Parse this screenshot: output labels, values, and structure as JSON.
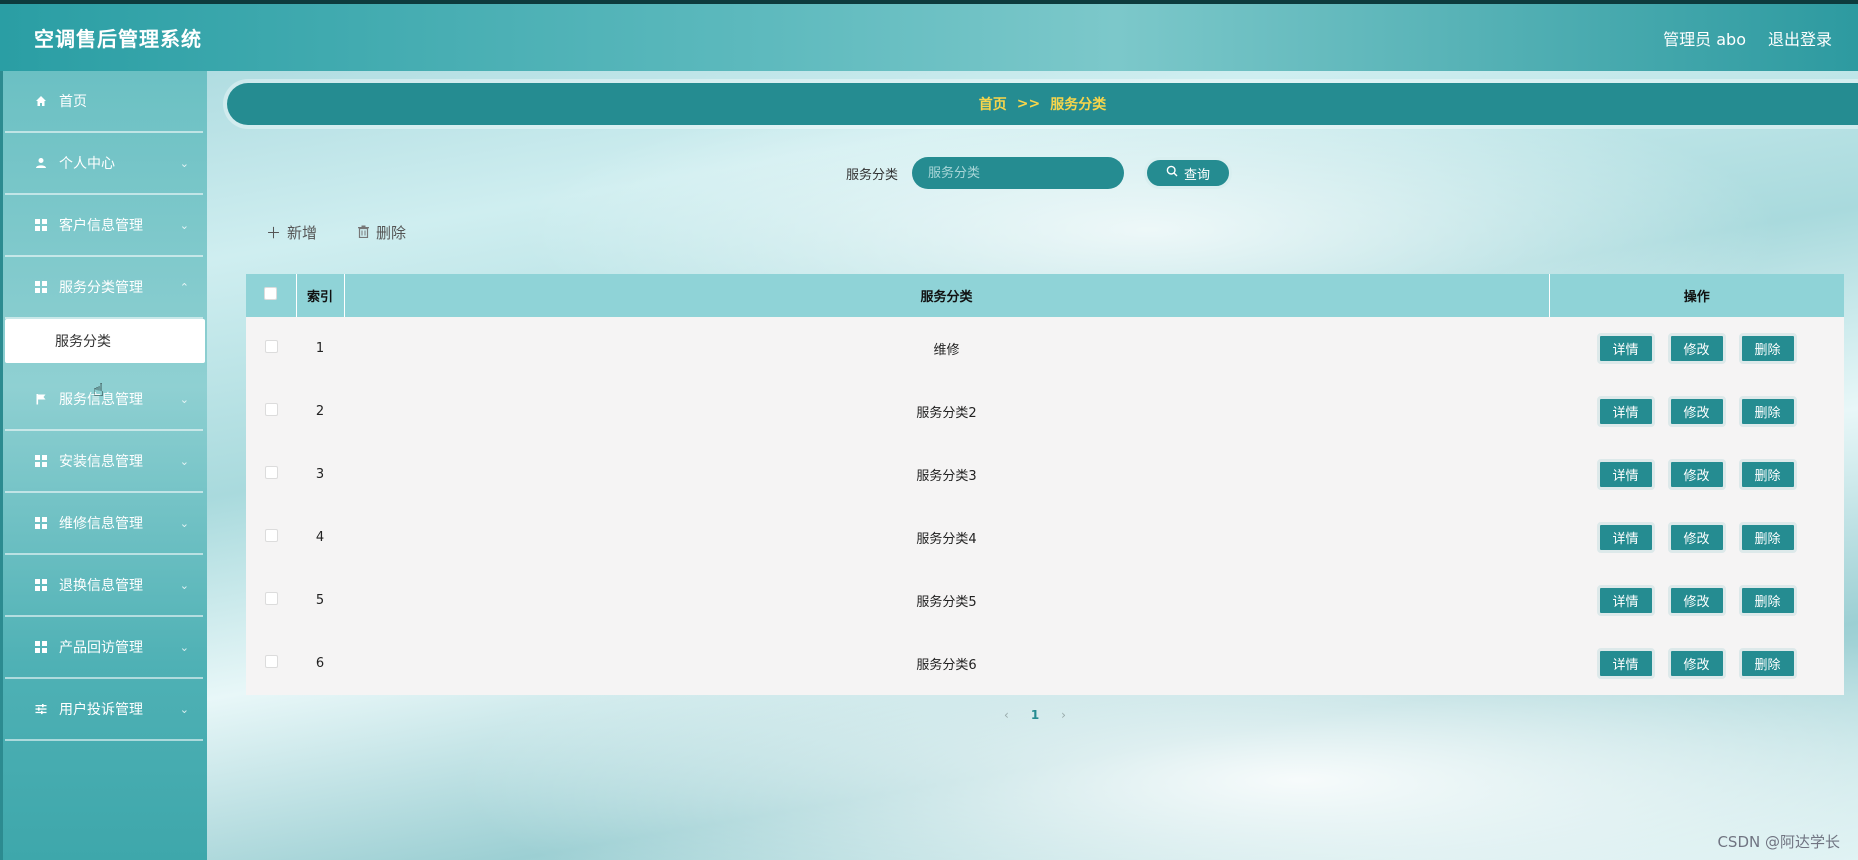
{
  "header": {
    "app_title": "空调售后管理系统",
    "user_label": "管理员 abo",
    "logout_label": "退出登录"
  },
  "sidebar": {
    "items": [
      {
        "label": "首页",
        "icon": "home-icon"
      },
      {
        "label": "个人中心",
        "icon": "user-icon"
      },
      {
        "label": "客户信息管理",
        "icon": "grid-icon"
      },
      {
        "label": "服务分类管理",
        "icon": "grid-icon"
      },
      {
        "label": "服务信息管理",
        "icon": "flag-icon"
      },
      {
        "label": "安装信息管理",
        "icon": "grid-icon"
      },
      {
        "label": "维修信息管理",
        "icon": "grid-icon"
      },
      {
        "label": "退换信息管理",
        "icon": "grid-icon"
      },
      {
        "label": "产品回访管理",
        "icon": "grid-icon"
      },
      {
        "label": "用户投诉管理",
        "icon": "sliders-icon"
      }
    ],
    "subitem": {
      "label": "服务分类"
    }
  },
  "breadcrumb": {
    "home": "首页",
    "sep": ">>",
    "current": "服务分类"
  },
  "search": {
    "label": "服务分类",
    "placeholder": "服务分类",
    "button_label": "查询"
  },
  "actions": {
    "add_label": "新增",
    "delete_label": "删除"
  },
  "table": {
    "headers": [
      "索引",
      "服务分类",
      "操作"
    ],
    "rows": [
      {
        "index": "1",
        "category": "维修"
      },
      {
        "index": "2",
        "category": "服务分类2"
      },
      {
        "index": "3",
        "category": "服务分类3"
      },
      {
        "index": "4",
        "category": "服务分类4"
      },
      {
        "index": "5",
        "category": "服务分类5"
      },
      {
        "index": "6",
        "category": "服务分类6"
      }
    ],
    "row_buttons": {
      "detail": "详情",
      "edit": "修改",
      "delete": "删除"
    }
  },
  "pagination": {
    "prev": "‹",
    "current": "1",
    "next": "›"
  },
  "watermark": "CSDN @阿达学长",
  "colors": {
    "accent": "#258c91",
    "breadcrumb_text": "#f7d54b",
    "table_header": "#8fd3d7"
  }
}
